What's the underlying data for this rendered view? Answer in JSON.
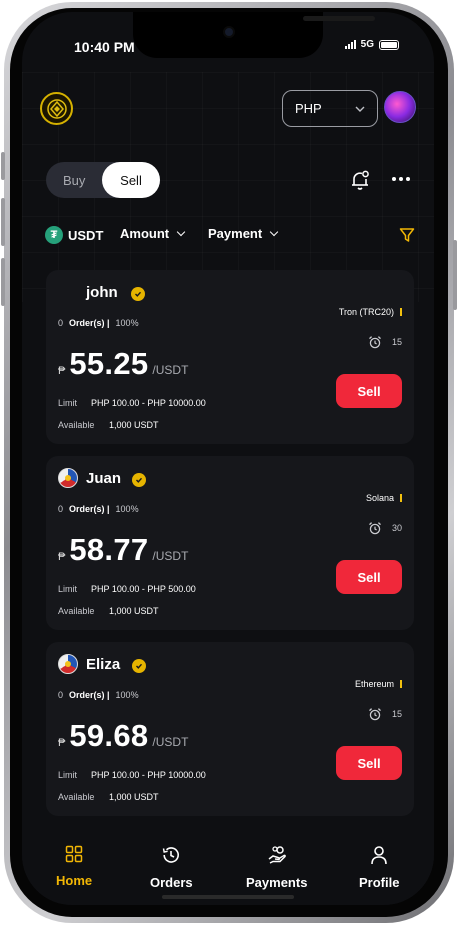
{
  "status_bar": {
    "time": "10:40 PM",
    "network": "5G"
  },
  "header": {
    "currency": "PHP"
  },
  "mode_toggle": {
    "buy_label": "Buy",
    "sell_label": "Sell",
    "selected": "Sell"
  },
  "filters": {
    "asset": "USDT",
    "amount": "Amount",
    "payment": "Payment"
  },
  "offers": [
    {
      "name": "john",
      "orders_count": "0",
      "orders_label": "Order(s) |",
      "completion": "100%",
      "network": "Tron (TRC20)",
      "time_limit": "15",
      "currency_symbol": "₱",
      "price": "55.25",
      "unit": "/USDT",
      "limit_label": "Limit",
      "limit": "PHP 100.00 - PHP 10000.00",
      "available_label": "Available",
      "available": "1,000 USDT",
      "action": "Sell",
      "has_avatar": false
    },
    {
      "name": "Juan",
      "orders_count": "0",
      "orders_label": "Order(s) |",
      "completion": "100%",
      "network": "Solana",
      "time_limit": "30",
      "currency_symbol": "₱",
      "price": "58.77",
      "unit": "/USDT",
      "limit_label": "Limit",
      "limit": "PHP 100.00 - PHP 500.00",
      "available_label": "Available",
      "available": "1,000 USDT",
      "action": "Sell",
      "has_avatar": true
    },
    {
      "name": "Eliza",
      "orders_count": "0",
      "orders_label": "Order(s) |",
      "completion": "100%",
      "network": "Ethereum",
      "time_limit": "15",
      "currency_symbol": "₱",
      "price": "59.68",
      "unit": "/USDT",
      "limit_label": "Limit",
      "limit": "PHP 100.00 - PHP 10000.00",
      "available_label": "Available",
      "available": "1,000 USDT",
      "action": "Sell",
      "has_avatar": true
    }
  ],
  "tab_bar": {
    "items": [
      {
        "label": "Home",
        "icon": "grid-icon",
        "active": true
      },
      {
        "label": "Orders",
        "icon": "clock-icon",
        "active": false
      },
      {
        "label": "Payments",
        "icon": "hand-money-icon",
        "active": false
      },
      {
        "label": "Profile",
        "icon": "person-icon",
        "active": false
      }
    ]
  },
  "colors": {
    "accent": "#f2b705",
    "sell_button": "#f0283a",
    "background": "#0e0f12",
    "card": "#16171b"
  }
}
